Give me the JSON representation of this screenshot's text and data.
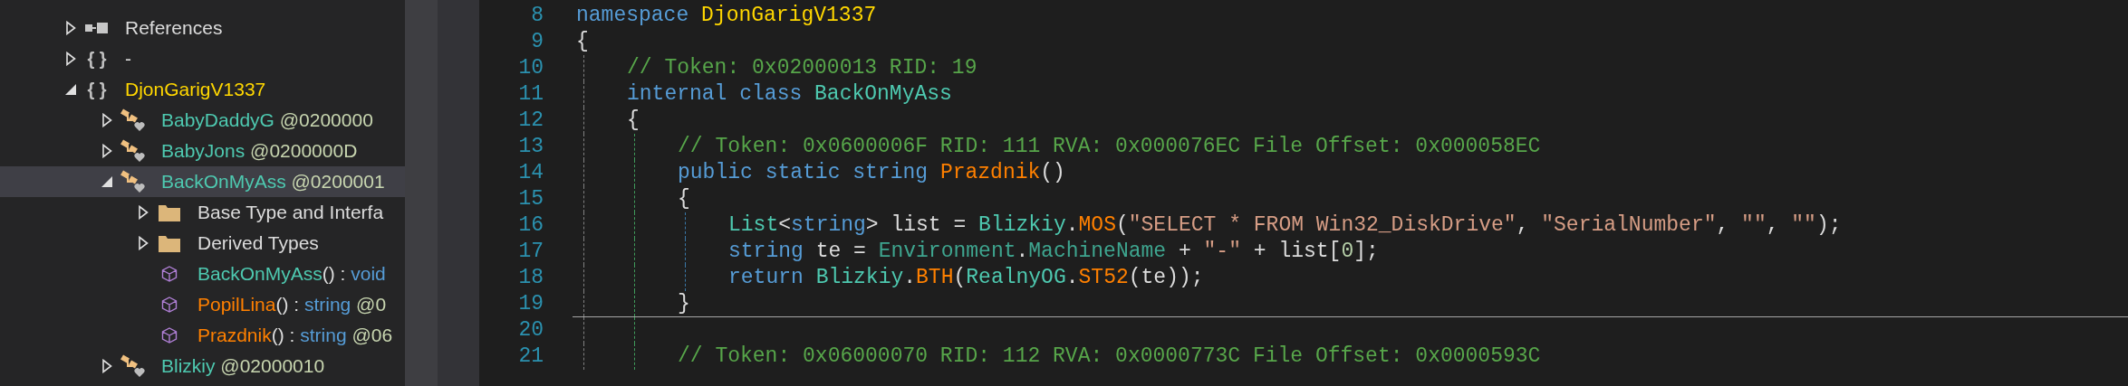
{
  "tree": [
    {
      "kind": "references",
      "expanded": false,
      "selected": false,
      "parts": [
        {
          "text": "References",
          "kind": "plain"
        }
      ]
    },
    {
      "kind": "namespace",
      "icon": "{ }",
      "expanded": false,
      "selected": false,
      "parts": [
        {
          "text": "-",
          "kind": "plain"
        }
      ]
    },
    {
      "kind": "namespace",
      "icon": "{ }",
      "expanded": true,
      "selected": false,
      "parts": [
        {
          "text": "DjonGarigV1337",
          "kind": "ns"
        }
      ],
      "children": [
        {
          "kind": "class",
          "expanded": false,
          "selected": false,
          "parts": [
            {
              "text": "BabyDaddyG",
              "kind": "type"
            },
            {
              "text": " @0200000",
              "kind": "token"
            }
          ]
        },
        {
          "kind": "class",
          "expanded": false,
          "selected": false,
          "parts": [
            {
              "text": "BabyJons",
              "kind": "type"
            },
            {
              "text": " @0200000D",
              "kind": "token"
            }
          ]
        },
        {
          "kind": "class",
          "expanded": true,
          "selected": true,
          "parts": [
            {
              "text": "BackOnMyAss",
              "kind": "type"
            },
            {
              "text": " @0200001",
              "kind": "token"
            }
          ],
          "children": [
            {
              "kind": "folder",
              "expanded": false,
              "selected": false,
              "parts": [
                {
                  "text": "Base Type and Interfa",
                  "kind": "plain"
                }
              ]
            },
            {
              "kind": "folder",
              "expanded": false,
              "selected": false,
              "parts": [
                {
                  "text": "Derived Types",
                  "kind": "plain"
                }
              ]
            },
            {
              "kind": "method",
              "selected": false,
              "parts": [
                {
                  "text": "BackOnMyAss",
                  "kind": "type"
                },
                {
                  "text": "() : ",
                  "kind": "plain"
                },
                {
                  "text": "void",
                  "kind": "kw"
                }
              ]
            },
            {
              "kind": "method",
              "selected": false,
              "parts": [
                {
                  "text": "PopilLina",
                  "kind": "method"
                },
                {
                  "text": "() : ",
                  "kind": "plain"
                },
                {
                  "text": "string",
                  "kind": "kw"
                },
                {
                  "text": " @0",
                  "kind": "token"
                }
              ]
            },
            {
              "kind": "method",
              "selected": false,
              "parts": [
                {
                  "text": "Prazdnik",
                  "kind": "method"
                },
                {
                  "text": "() : ",
                  "kind": "plain"
                },
                {
                  "text": "string",
                  "kind": "kw"
                },
                {
                  "text": " @06",
                  "kind": "token"
                }
              ]
            }
          ]
        },
        {
          "kind": "class",
          "expanded": false,
          "selected": false,
          "parts": [
            {
              "text": "Blizkiy",
              "kind": "type"
            },
            {
              "text": " @02000010",
              "kind": "token"
            }
          ]
        }
      ]
    }
  ],
  "code": [
    {
      "number": "8",
      "separator_after": false,
      "tokens": [
        {
          "text": "namespace",
          "kind": "kw"
        },
        {
          "text": " DjonGarigV1337",
          "kind": "ns"
        }
      ]
    },
    {
      "number": "9",
      "separator_after": false,
      "tokens": [
        {
          "text": "{",
          "kind": "plain"
        }
      ],
      "children": [
        {
          "number": "10",
          "separator_after": false,
          "tokens": [
            {
              "text": "// Token: 0x02000013 RID: 19",
              "kind": "comment"
            }
          ]
        },
        {
          "number": "11",
          "separator_after": false,
          "tokens": [
            {
              "text": "internal",
              "kind": "kw"
            },
            {
              "text": " class",
              "kind": "kw"
            },
            {
              "text": " BackOnMyAss",
              "kind": "type"
            }
          ]
        },
        {
          "number": "12",
          "separator_after": false,
          "tokens": [
            {
              "text": "{",
              "kind": "plain"
            }
          ],
          "children": [
            {
              "number": "13",
              "separator_after": false,
              "tokens": [
                {
                  "text": "// Token: 0x0600006F RID: 111 RVA: 0x000076EC File Offset: 0x000058EC",
                  "kind": "comment"
                }
              ]
            },
            {
              "number": "14",
              "separator_after": false,
              "tokens": [
                {
                  "text": "public",
                  "kind": "kw"
                },
                {
                  "text": " static",
                  "kind": "kw"
                },
                {
                  "text": " string",
                  "kind": "kw"
                },
                {
                  "text": " Prazdnik",
                  "kind": "method"
                },
                {
                  "text": "()",
                  "kind": "plain"
                }
              ]
            },
            {
              "number": "15",
              "separator_after": false,
              "tokens": [
                {
                  "text": "{",
                  "kind": "plain"
                }
              ],
              "children": [
                {
                  "number": "16",
                  "separator_after": false,
                  "tokens": [
                    {
                      "text": "List",
                      "kind": "type"
                    },
                    {
                      "text": "<",
                      "kind": "plain"
                    },
                    {
                      "text": "string",
                      "kind": "kw"
                    },
                    {
                      "text": "> list = ",
                      "kind": "plain"
                    },
                    {
                      "text": "Blizkiy",
                      "kind": "type"
                    },
                    {
                      "text": ".",
                      "kind": "plain"
                    },
                    {
                      "text": "MOS",
                      "kind": "method"
                    },
                    {
                      "text": "(",
                      "kind": "plain"
                    },
                    {
                      "text": "\"SELECT * FROM Win32_DiskDrive\"",
                      "kind": "string"
                    },
                    {
                      "text": ", ",
                      "kind": "plain"
                    },
                    {
                      "text": "\"SerialNumber\"",
                      "kind": "string"
                    },
                    {
                      "text": ", ",
                      "kind": "plain"
                    },
                    {
                      "text": "\"\"",
                      "kind": "string"
                    },
                    {
                      "text": ", ",
                      "kind": "plain"
                    },
                    {
                      "text": "\"\"",
                      "kind": "string"
                    },
                    {
                      "text": ");",
                      "kind": "plain"
                    }
                  ]
                },
                {
                  "number": "17",
                  "separator_after": false,
                  "tokens": [
                    {
                      "text": "string",
                      "kind": "kw"
                    },
                    {
                      "text": " te = ",
                      "kind": "plain"
                    },
                    {
                      "text": "Environment",
                      "kind": "type2"
                    },
                    {
                      "text": ".",
                      "kind": "plain"
                    },
                    {
                      "text": "MachineName",
                      "kind": "type2"
                    },
                    {
                      "text": " + ",
                      "kind": "plain"
                    },
                    {
                      "text": "\"-\"",
                      "kind": "string"
                    },
                    {
                      "text": " + list[",
                      "kind": "plain"
                    },
                    {
                      "text": "0",
                      "kind": "num"
                    },
                    {
                      "text": "];",
                      "kind": "plain"
                    }
                  ]
                },
                {
                  "number": "18",
                  "separator_after": false,
                  "tokens": [
                    {
                      "text": "return",
                      "kind": "kw"
                    },
                    {
                      "text": " Blizkiy",
                      "kind": "type"
                    },
                    {
                      "text": ".",
                      "kind": "plain"
                    },
                    {
                      "text": "BTH",
                      "kind": "method"
                    },
                    {
                      "text": "(",
                      "kind": "plain"
                    },
                    {
                      "text": "RealnyOG",
                      "kind": "type"
                    },
                    {
                      "text": ".",
                      "kind": "plain"
                    },
                    {
                      "text": "ST52",
                      "kind": "method"
                    },
                    {
                      "text": "(te));",
                      "kind": "plain"
                    }
                  ]
                }
              ]
            },
            {
              "number": "19",
              "separator_after": true,
              "tokens": [
                {
                  "text": "}",
                  "kind": "plain"
                }
              ]
            },
            {
              "number": "20",
              "separator_after": false
            },
            {
              "number": "21",
              "separator_after": false,
              "tokens": [
                {
                  "text": "// Token: 0x06000070 RID: 112 RVA: 0x0000773C File Offset: 0x0000593C",
                  "kind": "comment"
                }
              ]
            }
          ]
        }
      ]
    }
  ]
}
